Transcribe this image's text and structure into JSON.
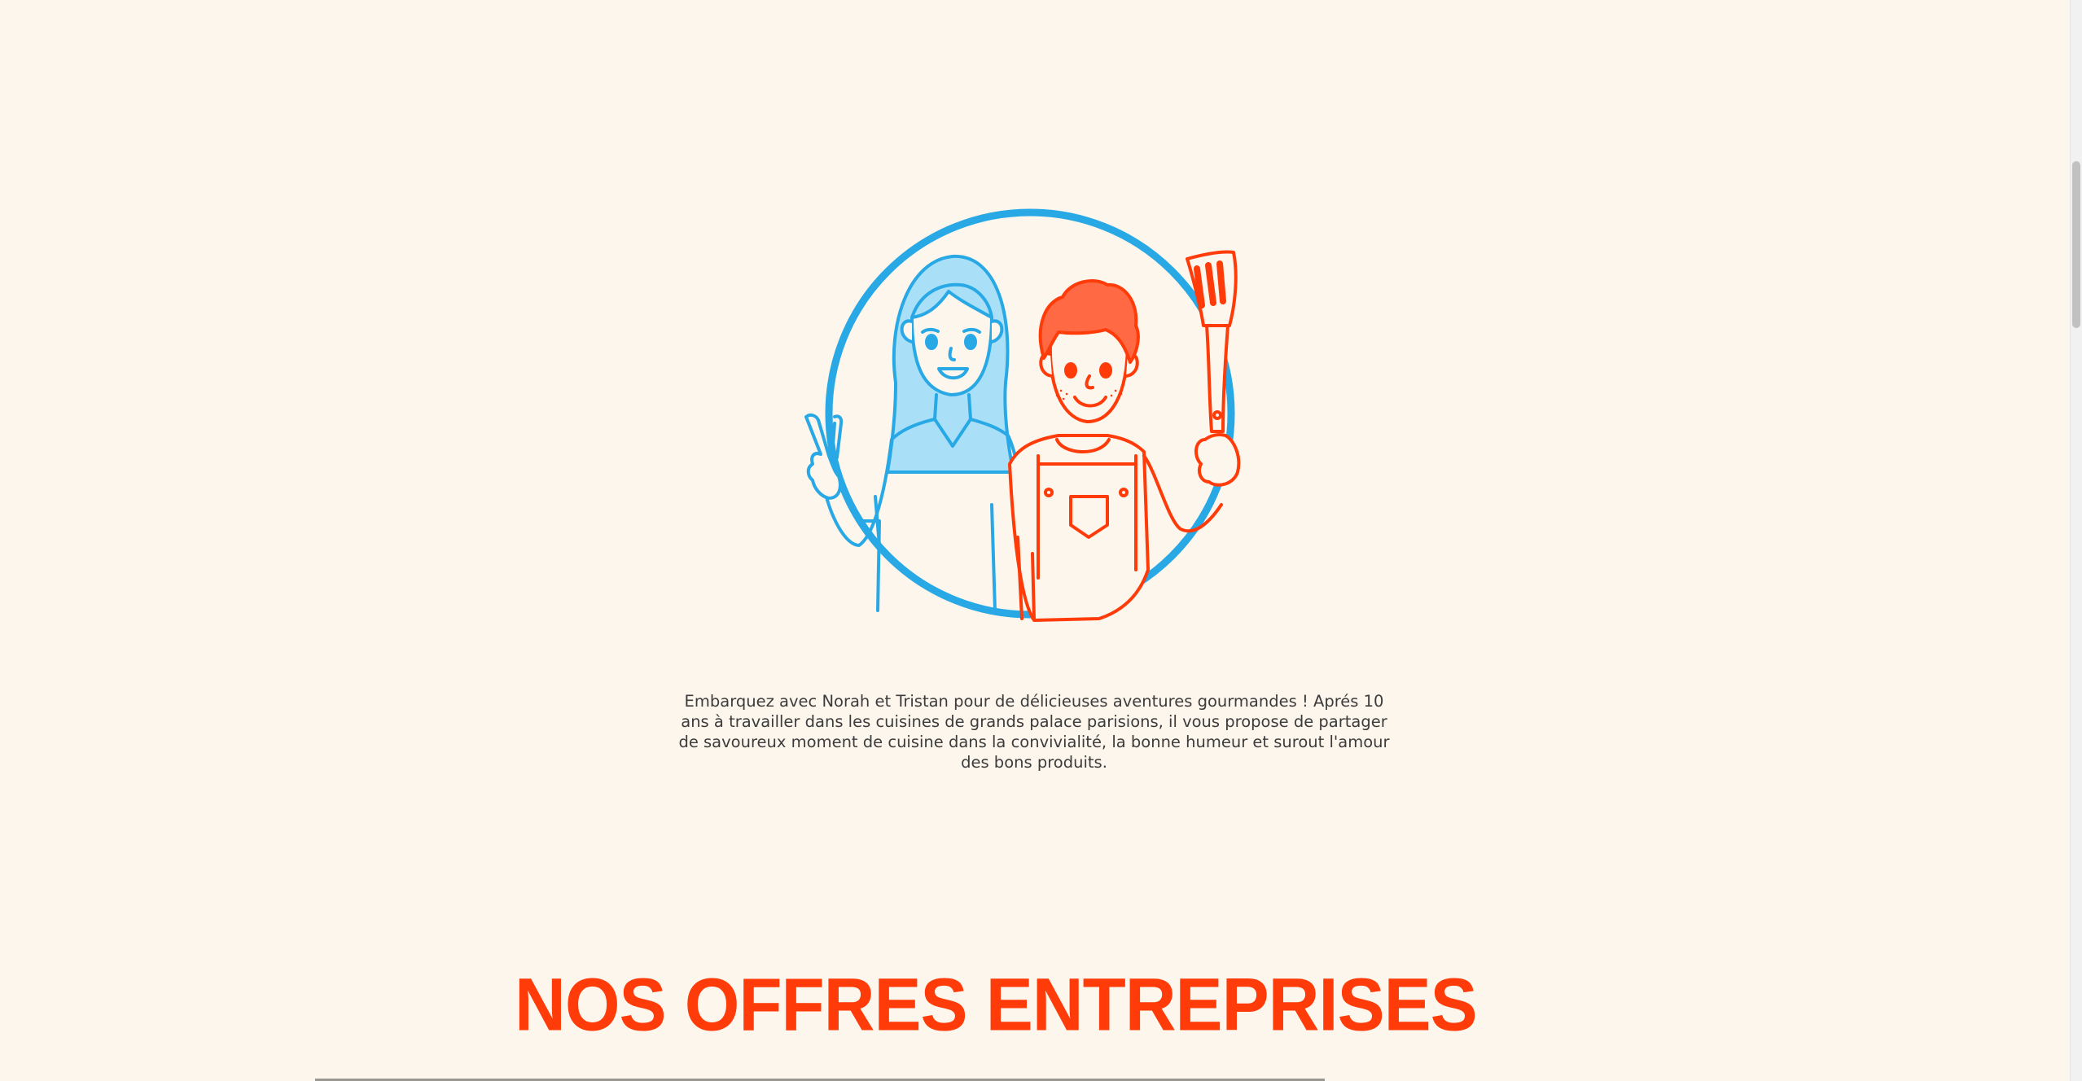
{
  "intro": {
    "text": "Embarquez avec Norah et Tristan pour de délicieuses aventures gourmandes ! Aprés 10 ans à travailler dans les cuisines de grands palace parisions, il vous propose de partager de savoureux moment de cuisine dans la convivialité, la bonne humeur et surout l'amour des bons produits."
  },
  "offers": {
    "title": "NOS OFFRES ENTREPRISES"
  },
  "colors": {
    "background": "#fcf6ec",
    "blue": "#29a8e6",
    "light_blue": "#a9e0f7",
    "red": "#ff3b0a",
    "text": "#3c3c3c"
  },
  "icons": {
    "illustration": "chefs-norah-tristan-illustration"
  }
}
